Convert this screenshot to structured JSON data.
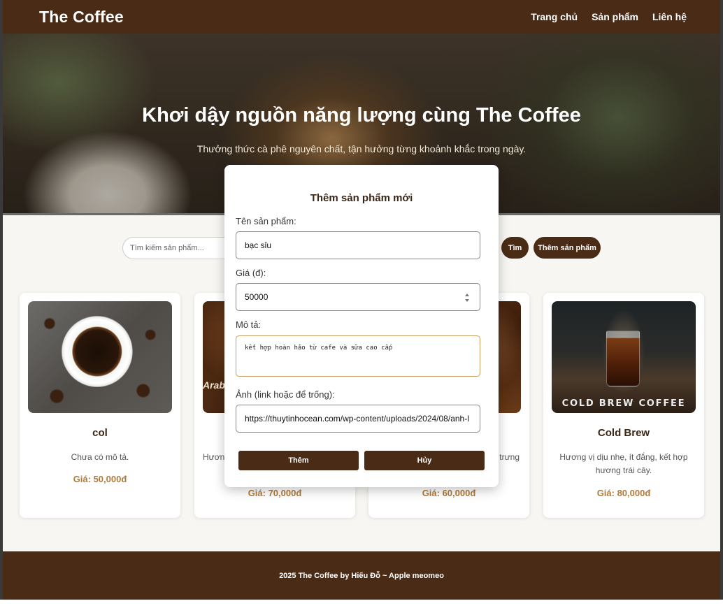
{
  "header": {
    "brand": "The Coffee",
    "nav": [
      "Trang chủ",
      "Sản phẩm",
      "Liên hệ"
    ]
  },
  "hero": {
    "title": "Khơi dậy nguồn năng lượng cùng The Coffee",
    "subtitle": "Thưởng thức cà phê nguyên chất, tận hưởng từng khoảnh khắc trong ngày."
  },
  "toolbar": {
    "search_placeholder": "Tìm kiếm sản phẩm...",
    "search_button": "Tìm",
    "add_button": "Thêm sản phẩm"
  },
  "products": [
    {
      "name": "col",
      "description": "Chưa có mô tả.",
      "price": "Giá: 50,000đ"
    },
    {
      "name": "",
      "description": "Hươn",
      "price": "Giá: 70,000đ"
    },
    {
      "name": "",
      "description": "trưng",
      "price": "Giá: 60,000đ"
    },
    {
      "name": "Cold Brew",
      "description": "Hương vị dịu nhẹ, ít đắng, kết hợp hương trái cây.",
      "price": "Giá: 80,000đ",
      "image_text": "COLD BREW COFFEE"
    }
  ],
  "card_visible_text": {
    "card2_image_text": "Arab"
  },
  "modal": {
    "title": "Thêm sản phẩm mới",
    "name_label": "Tên sản phẩm:",
    "name_value": "bạc sỉu",
    "price_label": "Giá (đ):",
    "price_value": "50000",
    "desc_label": "Mô tả:",
    "desc_value": "kết hợp hoàn hảo từ cafe và sữa cao cấp",
    "image_label": "Ảnh (link hoặc để trống):",
    "image_value": "https://thuytinhocean.com/wp-content/uploads/2024/08/anh-l",
    "submit_label": "Thêm",
    "cancel_label": "Hủy"
  },
  "footer": {
    "text": "2025 The Coffee by Hiếu Đỗ ~ Apple meomeo"
  },
  "colors": {
    "brand_brown": "#4a2b15",
    "price_gold": "#b07b3a"
  }
}
